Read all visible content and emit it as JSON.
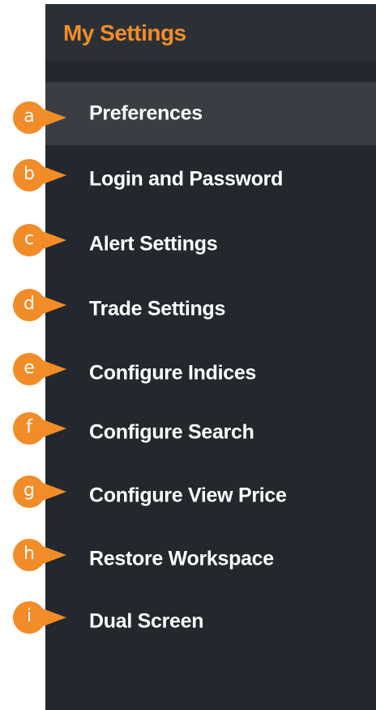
{
  "panel": {
    "title": "My Settings"
  },
  "menu": {
    "items": [
      {
        "label": "Preferences",
        "letter": "a",
        "selected": true
      },
      {
        "label": "Login and Password",
        "letter": "b"
      },
      {
        "label": "Alert Settings",
        "letter": "c"
      },
      {
        "label": "Trade Settings",
        "letter": "d"
      },
      {
        "label": "Configure Indices",
        "letter": "e"
      },
      {
        "label": "Configure Search",
        "letter": "f"
      },
      {
        "label": "Configure View Price",
        "letter": "g"
      },
      {
        "label": "Restore Workspace",
        "letter": "h"
      },
      {
        "label": "Dual Screen",
        "letter": "i"
      }
    ]
  },
  "colors": {
    "accent": "#f28c28",
    "panel_bg": "#23282e",
    "header_bg": "#2b3037",
    "selected_bg": "#3a3e44",
    "text": "#ffffff"
  }
}
